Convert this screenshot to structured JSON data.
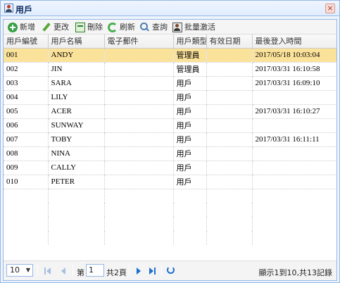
{
  "window": {
    "title": "用戶"
  },
  "toolbar": {
    "add": "新增",
    "edit": "更改",
    "delete": "刪除",
    "refresh": "刷新",
    "search": "查詢",
    "batch_activate": "批量激活"
  },
  "grid": {
    "columns": [
      "用戶編號",
      "用戶名稱",
      "電子郵件",
      "用戶類型",
      "有效日期",
      "最後登入時間"
    ],
    "rows": [
      {
        "id": "001",
        "name": "ANDY",
        "email": "",
        "type": "管理員",
        "valid": "",
        "last_login": "2017/05/18 10:03:04"
      },
      {
        "id": "002",
        "name": "JIN",
        "email": "",
        "type": "管理員",
        "valid": "",
        "last_login": "2017/03/31 16:10:58"
      },
      {
        "id": "003",
        "name": "SARA",
        "email": "",
        "type": "用戶",
        "valid": "",
        "last_login": "2017/03/31 16:09:10"
      },
      {
        "id": "004",
        "name": "LILY",
        "email": "",
        "type": "用戶",
        "valid": "",
        "last_login": ""
      },
      {
        "id": "005",
        "name": "ACER",
        "email": "",
        "type": "用戶",
        "valid": "",
        "last_login": "2017/03/31 16:10:27"
      },
      {
        "id": "006",
        "name": "SUNWAY",
        "email": "",
        "type": "用戶",
        "valid": "",
        "last_login": ""
      },
      {
        "id": "007",
        "name": "TOBY",
        "email": "",
        "type": "用戶",
        "valid": "",
        "last_login": "2017/03/31 16:11:11"
      },
      {
        "id": "008",
        "name": "NINA",
        "email": "",
        "type": "用戶",
        "valid": "",
        "last_login": ""
      },
      {
        "id": "009",
        "name": "CALLY",
        "email": "",
        "type": "用戶",
        "valid": "",
        "last_login": ""
      },
      {
        "id": "010",
        "name": "PETER",
        "email": "",
        "type": "用戶",
        "valid": "",
        "last_login": ""
      }
    ],
    "selected_row_id": "001"
  },
  "pager": {
    "page_size": "10",
    "page_label_before": "第",
    "current_page": "1",
    "page_label_after": "共2頁",
    "info": "顯示1到10,共13記錄"
  },
  "colors": {
    "selected_row": "#fbe29a",
    "border": "#95b8e7",
    "accent": "#1f6fd1"
  }
}
